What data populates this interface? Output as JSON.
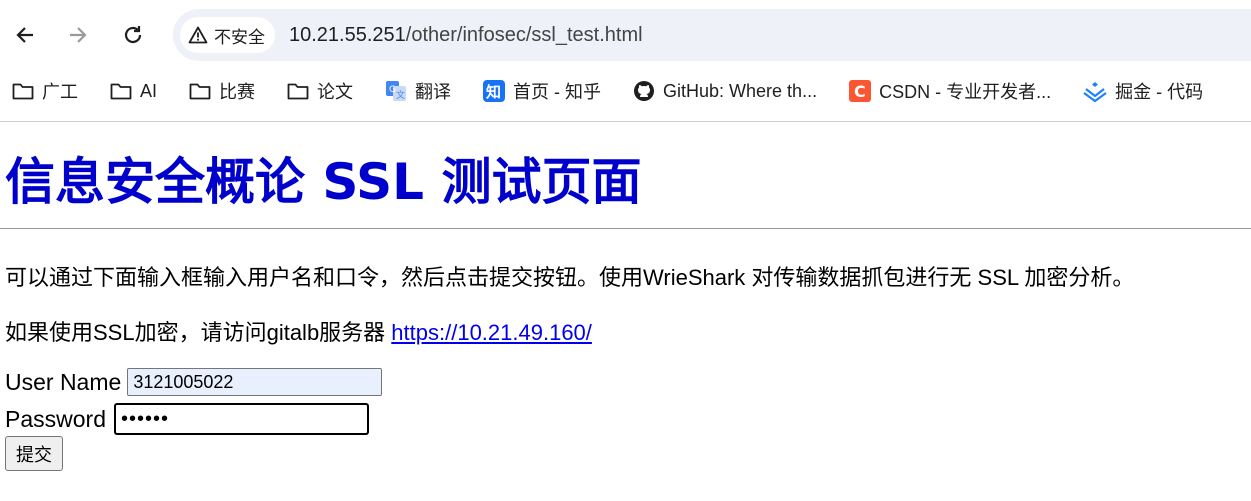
{
  "browser": {
    "back_icon": "arrow-left-icon",
    "forward_icon": "arrow-right-icon",
    "reload_icon": "reload-icon",
    "security_label": "不安全",
    "url_host": "10.21.55.251",
    "url_path": "/other/infosec/ssl_test.html"
  },
  "bookmarks": [
    {
      "label": "广工",
      "icon": "folder-icon"
    },
    {
      "label": "AI",
      "icon": "folder-icon"
    },
    {
      "label": "比赛",
      "icon": "folder-icon"
    },
    {
      "label": "论文",
      "icon": "folder-icon"
    },
    {
      "label": "翻译",
      "icon": "translate-icon"
    },
    {
      "label": "首页 - 知乎",
      "icon": "zhihu-icon"
    },
    {
      "label": "GitHub: Where th...",
      "icon": "github-icon"
    },
    {
      "label": "CSDN - 专业开发者...",
      "icon": "csdn-icon"
    },
    {
      "label": "掘金 - 代码",
      "icon": "juejin-icon"
    }
  ],
  "page": {
    "title": "信息安全概论 SSL 测试页面",
    "intro": "可以通过下面输入框输入用户名和口令，然后点击提交按钮。使用WrieShark 对传输数据抓包进行无 SSL 加密分析。",
    "ssl_text": "如果使用SSL加密，请访问gitalb服务器 ",
    "ssl_link": "https://10.21.49.160/"
  },
  "form": {
    "username_label": "User Name",
    "username_value": "3121005022",
    "password_label": "Password",
    "password_value": "••••••",
    "submit_label": "提交"
  },
  "colors": {
    "title": "#0000cc",
    "link": "#0000ee",
    "omnibox_bg": "#eef1f8",
    "autofill_bg": "#e8f0fe"
  }
}
